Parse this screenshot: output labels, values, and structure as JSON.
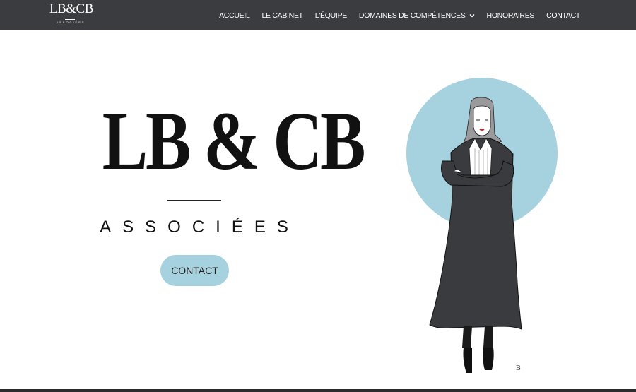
{
  "header": {
    "logo_mono": "LB&CB",
    "logo_sub": "ASSOCIÉES",
    "nav": [
      {
        "label": "ACCUEIL"
      },
      {
        "label": "LE CABINET"
      },
      {
        "label": "L'ÉQUIPE"
      },
      {
        "label": "DOMAINES DE COMPÉTENCES",
        "has_dropdown": true
      },
      {
        "label": "HONORAIRES"
      },
      {
        "label": "CONTACT"
      }
    ]
  },
  "hero": {
    "title": "LB & CB",
    "subtitle": "ASSOCIÉES",
    "button_label": "CONTACT"
  },
  "illustration": {
    "icon": "lawyer-illustration",
    "signature": "B"
  },
  "colors": {
    "header_bg": "#3b3c3f",
    "accent": "#a6d2df",
    "text": "#111111"
  }
}
